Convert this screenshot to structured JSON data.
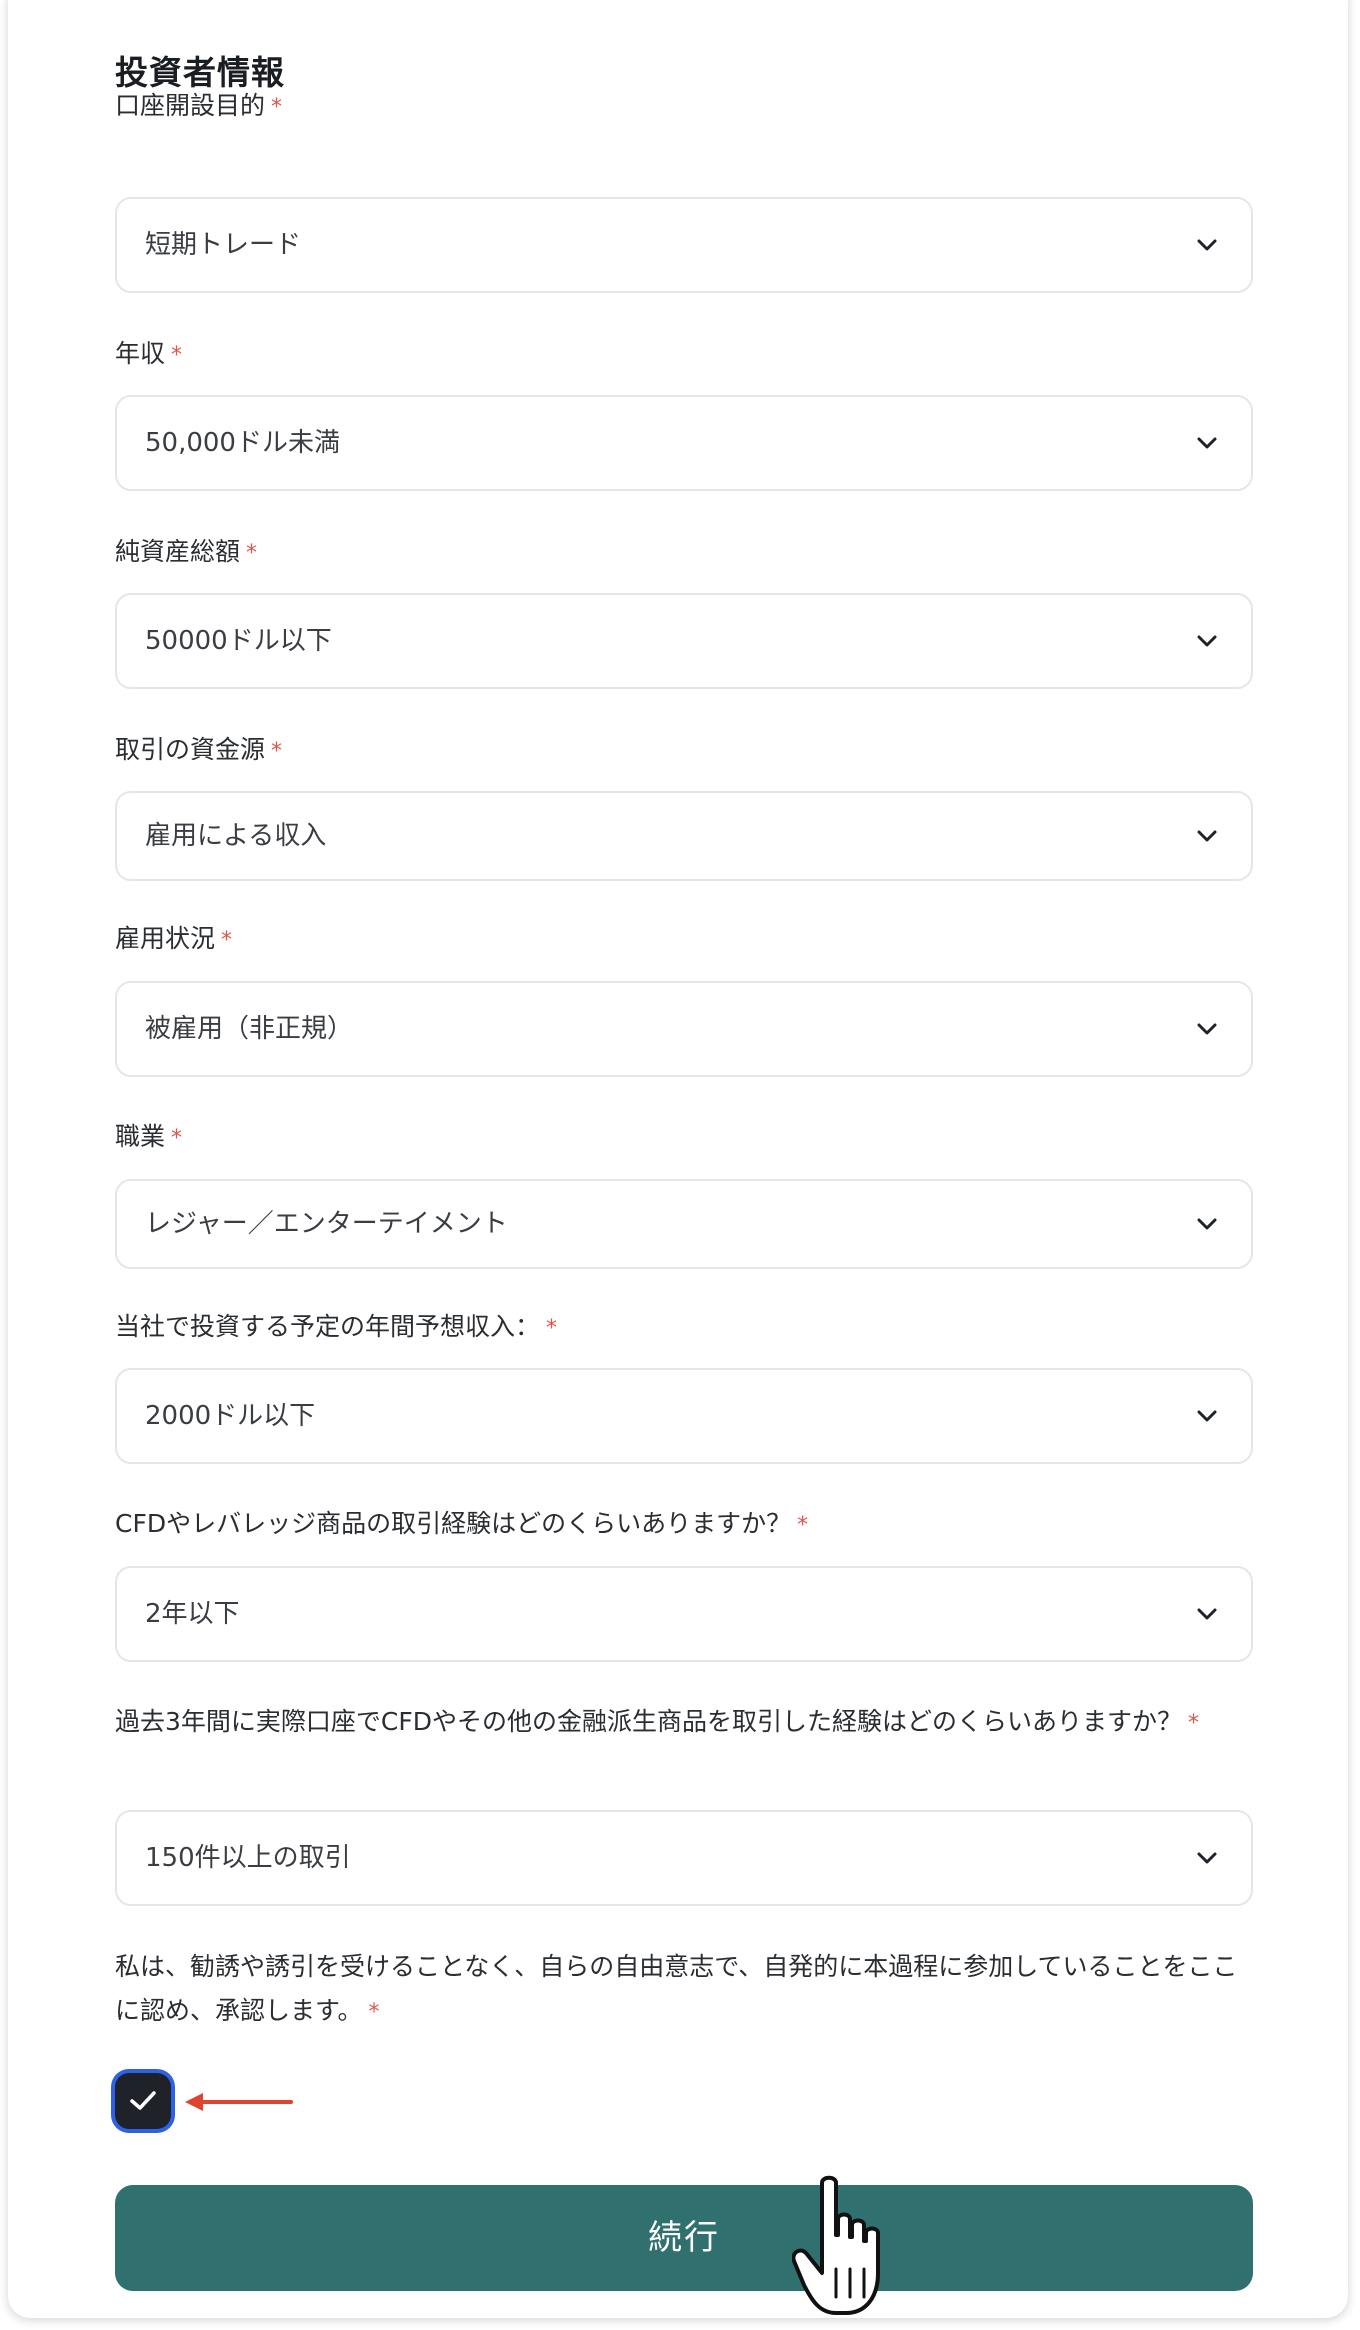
{
  "section": {
    "title": "投資者情報"
  },
  "required_mark": "*",
  "fields": [
    {
      "label": "口座開設目的",
      "value": "短期トレード"
    },
    {
      "label": "年収",
      "value": "50,000ドル未満"
    },
    {
      "label": "純資産総額",
      "value": "50000ドル以下"
    },
    {
      "label": "取引の資金源",
      "value": "雇用による収入"
    },
    {
      "label": "雇用状況",
      "value": "被雇用（非正規）"
    },
    {
      "label": "職業",
      "value": "レジャー／エンターテイメント"
    },
    {
      "label": "当社で投資する予定の年間予想収入：",
      "value": "2000ドル以下"
    },
    {
      "label": "CFDやレバレッジ商品の取引経験はどのくらいありますか？",
      "value": "2年以下"
    },
    {
      "label": "過去3年間に実際口座でCFDやその他の金融派生商品を取引した経験はどのくらいありますか？",
      "value": "150件以上の取引"
    }
  ],
  "consent": {
    "text": "私は、勧誘や誘引を受けることなく、自らの自由意志で、自発的に本過程に参加していることをここに認め、承認します。",
    "checked": true
  },
  "continue_button": {
    "label": "続行"
  },
  "colors": {
    "primary_button": "#30716f",
    "required": "#e0554b",
    "checkbox_fill": "#1f2329",
    "checkbox_focus_ring": "#2d62e8",
    "annotation_arrow": "#e0442f"
  },
  "icons": {
    "select_chevron": "chevron-down-icon",
    "checkbox_mark": "checkmark-icon",
    "annotation": "red-arrow-icon",
    "cursor": "hand-pointer-icon"
  }
}
